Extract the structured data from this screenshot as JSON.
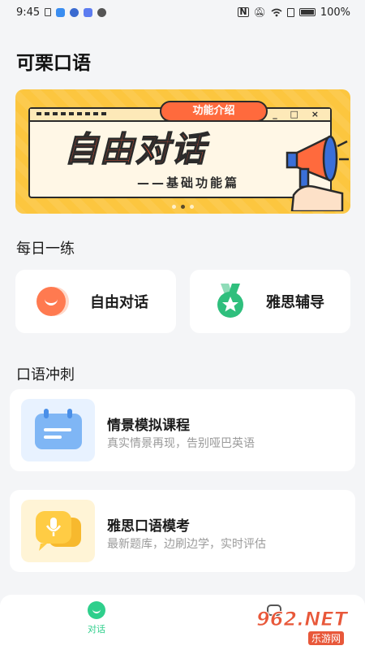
{
  "status_bar": {
    "time": "9:45",
    "battery": "100%"
  },
  "app": {
    "title": "可栗口语"
  },
  "banner": {
    "tag": "功能介绍",
    "headline": "自由对话",
    "subtitle": "——基础功能篇",
    "window_controls": "_ □ ×"
  },
  "daily": {
    "heading": "每日一练",
    "cards": [
      {
        "label": "自由对话",
        "icon": "smile-icon"
      },
      {
        "label": "雅思辅导",
        "icon": "medal-icon"
      }
    ]
  },
  "sprint": {
    "heading": "口语冲刺",
    "cards": [
      {
        "title": "情景模拟课程",
        "desc": "真实情景再现，告别哑巴英语",
        "icon": "calendar-chat-icon"
      },
      {
        "title": "雅思口语模考",
        "desc": "最新题库，边刷边学，实时评估",
        "icon": "microphone-chat-icon"
      }
    ]
  },
  "tab_bar": {
    "tabs": [
      {
        "label": "对话",
        "active": true,
        "icon": "smile-tab-icon"
      },
      {
        "label": "",
        "active": false,
        "icon": "robot-tab-icon"
      }
    ]
  },
  "watermark": {
    "brand": "962.NET",
    "sub": "乐游网"
  },
  "colors": {
    "accent_green": "#2fcf8c",
    "orange": "#ff7a50",
    "banner_yellow": "#fcc63f",
    "blue_card": "#e8f2ff",
    "yellow_card": "#fff4d6"
  }
}
